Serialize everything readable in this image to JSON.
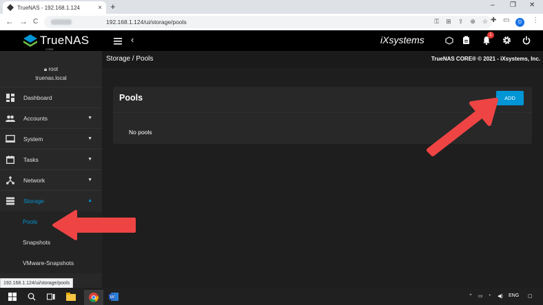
{
  "browser": {
    "tab_title": "TrueNAS - 192.168.1.124",
    "tab_close": "×",
    "new_tab": "+",
    "url": "192.168.1.124/ui/storage/pools",
    "profile_letter": "D",
    "status_url": "192.168.1.124/ui/storage/pools",
    "window_controls": [
      "–",
      "❐",
      "✕"
    ],
    "nav": [
      "←",
      "→",
      "C"
    ]
  },
  "header": {
    "logo_text": "TrueNAS",
    "logo_sub": "CORE",
    "ixsystems": "iXsystems",
    "alerts_count": "1"
  },
  "sidebar": {
    "user": "root",
    "host": "truenas.local",
    "items": [
      {
        "label": "Dashboard",
        "icon": "dashboard-icon",
        "expandable": false
      },
      {
        "label": "Accounts",
        "icon": "accounts-icon",
        "expandable": true
      },
      {
        "label": "System",
        "icon": "system-icon",
        "expandable": true
      },
      {
        "label": "Tasks",
        "icon": "tasks-icon",
        "expandable": true
      },
      {
        "label": "Network",
        "icon": "network-icon",
        "expandable": true
      },
      {
        "label": "Storage",
        "icon": "storage-icon",
        "expandable": true,
        "expanded": true
      }
    ],
    "sub_items": [
      "Pools",
      "Snapshots",
      "VMware-Snapshots"
    ]
  },
  "main": {
    "breadcrumb": "Storage / Pools",
    "copyright": "TrueNAS CORE® © 2021 - iXsystems, Inc.",
    "card_title": "Pools",
    "add_label": "ADD",
    "empty_text": "No pools"
  },
  "taskbar": {
    "lang": "ENG"
  },
  "colors": {
    "accent": "#0095d5",
    "arrow": "#ef4444",
    "sidebar_bg": "#282828",
    "content_bg": "#1e1e1e"
  }
}
